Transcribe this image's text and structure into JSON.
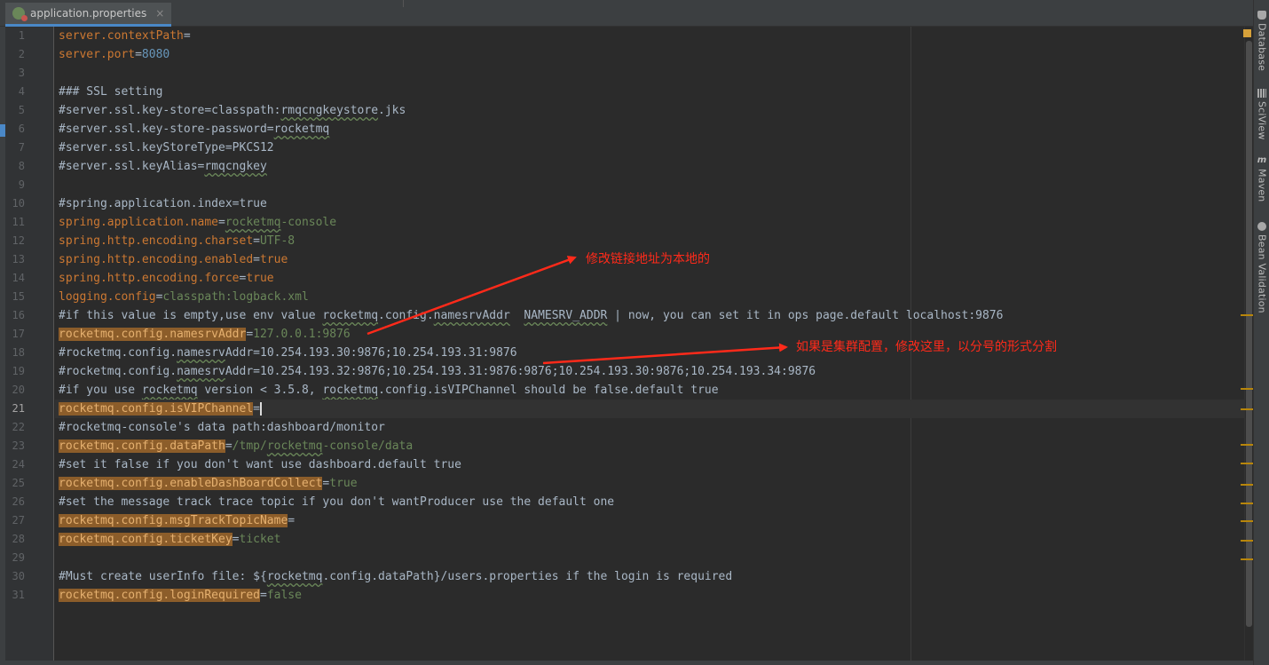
{
  "tab": {
    "label": "application.properties",
    "close": "×"
  },
  "right_tools": [
    {
      "label": "Database",
      "icon": "database-icon"
    },
    {
      "label": "SciView",
      "icon": "sciview-icon"
    },
    {
      "label": "Maven",
      "icon": "maven-icon"
    },
    {
      "label": "Bean Validation",
      "icon": "bean-validation-icon"
    }
  ],
  "current_line": 21,
  "annotations": {
    "local": "修改链接地址为本地的",
    "cluster": "如果是集群配置，修改这里，以分号的形式分割"
  },
  "lines": [
    [
      [
        "key",
        "server.contextPath"
      ],
      [
        "cmt",
        "="
      ]
    ],
    [
      [
        "key",
        "server.port"
      ],
      [
        "cmt",
        "="
      ],
      [
        "num",
        "8080"
      ]
    ],
    [],
    [
      [
        "cmt",
        "### SSL setting"
      ]
    ],
    [
      [
        "cmt",
        "#server.ssl.key-store=classpath:"
      ],
      [
        "cmt sq",
        "rmqcngkeystore"
      ],
      [
        "cmt",
        ".jks"
      ]
    ],
    [
      [
        "cmt",
        "#server.ssl.key-store-password="
      ],
      [
        "cmt sq",
        "rocketmq"
      ]
    ],
    [
      [
        "cmt",
        "#server.ssl.keyStoreType=PKCS12"
      ]
    ],
    [
      [
        "cmt",
        "#server.ssl.keyAlias="
      ],
      [
        "cmt sq",
        "rmqcngkey"
      ]
    ],
    [],
    [
      [
        "cmt",
        "#spring.application.index=true"
      ]
    ],
    [
      [
        "key",
        "spring.application.name"
      ],
      [
        "cmt",
        "="
      ],
      [
        "val sq",
        "rocketmq"
      ],
      [
        "val",
        "-console"
      ]
    ],
    [
      [
        "key",
        "spring.http.encoding.charset"
      ],
      [
        "cmt",
        "="
      ],
      [
        "val",
        "UTF-8"
      ]
    ],
    [
      [
        "key",
        "spring.http.encoding.enabled"
      ],
      [
        "cmt",
        "="
      ],
      [
        "kw",
        "true"
      ]
    ],
    [
      [
        "key",
        "spring.http.encoding.force"
      ],
      [
        "cmt",
        "="
      ],
      [
        "kw",
        "true"
      ]
    ],
    [
      [
        "key",
        "logging.config"
      ],
      [
        "cmt",
        "="
      ],
      [
        "val",
        "classpath:logback.xml"
      ]
    ],
    [
      [
        "cmt",
        "#if this value is empty,use env value "
      ],
      [
        "cmt sq",
        "rocketmq"
      ],
      [
        "cmt",
        ".config."
      ],
      [
        "cmt sq",
        "namesrvAddr"
      ],
      [
        "cmt",
        "  "
      ],
      [
        "cmt sq",
        "NAMESRV_ADDR"
      ],
      [
        "cmt",
        " | now, you can set it in ops page.default localhost:9876"
      ]
    ],
    [
      [
        "key hl",
        "rocketmq.config.namesrvAddr"
      ],
      [
        "cmt",
        "="
      ],
      [
        "val",
        "127.0.0.1:9876"
      ]
    ],
    [
      [
        "cmt",
        "#rocketmq.config."
      ],
      [
        "cmt sq",
        "namesrv"
      ],
      [
        "cmt",
        "Addr=10.254.193.30:9876;10.254.193.31:9876"
      ]
    ],
    [
      [
        "cmt",
        "#rocketmq.config."
      ],
      [
        "cmt sq",
        "namesrv"
      ],
      [
        "cmt",
        "Addr=10.254.193.32:9876;10.254.193.31:9876:9876;10.254.193.30:9876;10.254.193.34:9876"
      ]
    ],
    [
      [
        "cmt",
        "#if you use "
      ],
      [
        "cmt sq",
        "rocketmq"
      ],
      [
        "cmt",
        " version < 3.5.8, "
      ],
      [
        "cmt sq",
        "rocketmq"
      ],
      [
        "cmt",
        ".config.isVIPChannel should be false.default true"
      ]
    ],
    [
      [
        "key hl",
        "rocketmq.config.isVIPChannel"
      ],
      [
        "cmt",
        "="
      ],
      [
        "caret",
        ""
      ]
    ],
    [
      [
        "cmt",
        "#rocketmq-console's data path:dashboard/monitor"
      ]
    ],
    [
      [
        "key hl",
        "rocketmq.config.dataPath"
      ],
      [
        "cmt",
        "="
      ],
      [
        "val",
        "/tmp/"
      ],
      [
        "val sq",
        "rocketmq"
      ],
      [
        "val",
        "-console/data"
      ]
    ],
    [
      [
        "cmt",
        "#set it false if you don't want use dashboard.default true"
      ]
    ],
    [
      [
        "key hl",
        "rocketmq.config.enableDashBoardCollect"
      ],
      [
        "cmt",
        "="
      ],
      [
        "val",
        "true"
      ]
    ],
    [
      [
        "cmt",
        "#set the message track trace topic if you don't wantProducer use the default one"
      ]
    ],
    [
      [
        "key hl",
        "rocketmq.config.msgTrackTopicName"
      ],
      [
        "cmt",
        "="
      ]
    ],
    [
      [
        "key hl",
        "rocketmq.config.ticketKey"
      ],
      [
        "cmt",
        "="
      ],
      [
        "val",
        "ticket"
      ]
    ],
    [],
    [
      [
        "cmt",
        "#Must create userInfo file: ${"
      ],
      [
        "cmt sq",
        "rocketmq"
      ],
      [
        "cmt",
        ".config.dataPath}/users.properties if the login is required"
      ]
    ],
    [
      [
        "key hl",
        "rocketmq.config.loginRequired"
      ],
      [
        "cmt",
        "="
      ],
      [
        "val",
        "false"
      ]
    ]
  ]
}
